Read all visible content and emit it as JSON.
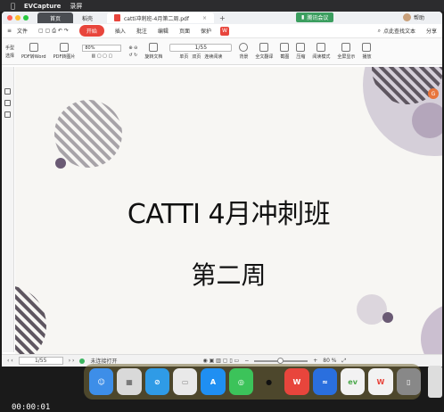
{
  "menubar": {
    "app_name": "EVCapture",
    "item": "录屏"
  },
  "tabs": {
    "home": "首页",
    "wao": "稻壳",
    "doc": "catti冲刺班-4月第二周.pdf",
    "new_tab": "+"
  },
  "meeting_badge": "腾讯会议",
  "user_badge": "帮助",
  "menu": {
    "file": "文件",
    "start": "开始",
    "insert": "插入",
    "annotate": "批注",
    "edit": "编辑",
    "page": "页面",
    "protect": "保护",
    "search": "点此查找文本",
    "share": "分享"
  },
  "ribbon": {
    "hand": "手型",
    "select": "选择",
    "pdf_to_word": "PDF转Word",
    "pdf_to_image": "PDF转图片",
    "zoom": "80%",
    "rotate": "旋转文档",
    "page_field": "1/55",
    "single": "单页",
    "double": "双页",
    "continuous": "连续阅读",
    "background": "背景",
    "full_translate": "全文翻译",
    "screenshot": "截图",
    "compress": "压缩",
    "read_mode": "阅读模式",
    "fullscreen": "全屏显示",
    "play": "播放"
  },
  "document": {
    "title": "CATTI 4月冲刺班",
    "subtitle": "第二周"
  },
  "statusbar": {
    "page": "1/55",
    "auto": "未连接打开",
    "zoom": "80 %"
  },
  "dock": {
    "finder": "Finder",
    "launchpad": "Launchpad",
    "safari": "Safari",
    "folder": "Folder",
    "appstore": "App Store",
    "wechat": "WeChat",
    "qq": "QQ",
    "wps": "WPS",
    "meeting": "会议",
    "ev": "EV",
    "wps2": "WPS"
  },
  "recording_time": "00:00:01"
}
